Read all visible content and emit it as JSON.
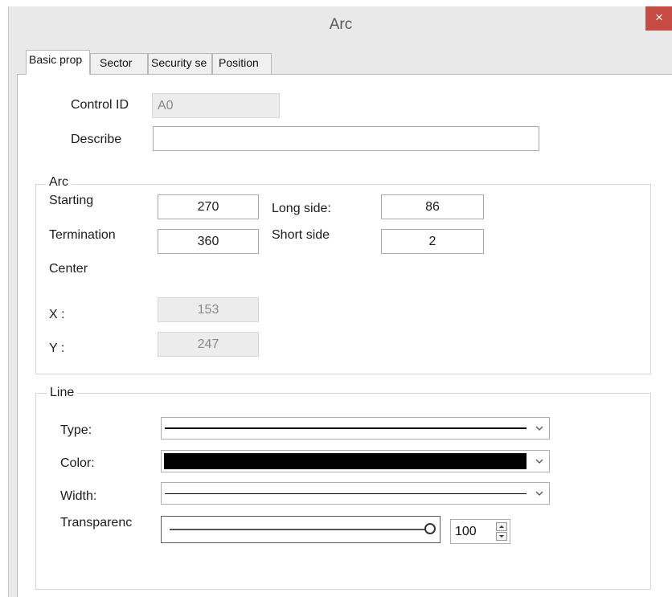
{
  "window": {
    "title": "Arc",
    "close_glyph": "×"
  },
  "tabs": [
    {
      "label": "Basic prop",
      "active": true
    },
    {
      "label": "Sector"
    },
    {
      "label": "Security se"
    },
    {
      "label": "Position"
    }
  ],
  "basic": {
    "control_id_label": "Control ID",
    "control_id_value": "A0",
    "describe_label": "Describe",
    "describe_value": ""
  },
  "arc": {
    "legend": "Arc",
    "starting_label": "Starting",
    "starting_value": "270",
    "termination_label": "Termination",
    "termination_value": "360",
    "long_side_label": "Long side:",
    "long_side_value": "86",
    "short_side_label": "Short side",
    "short_side_value": "2",
    "center_label": "Center",
    "x_label": "X :",
    "x_value": "153",
    "y_label": "Y :",
    "y_value": "247"
  },
  "line": {
    "legend": "Line",
    "type_label": "Type:",
    "color_label": "Color:",
    "color_value": "#000000",
    "width_label": "Width:",
    "transparency_label": "Transparenc",
    "transparency_value": "100",
    "transparency_level": 1.0
  },
  "icons": [
    "close-icon",
    "chevron-down-icon",
    "slider-thumb",
    "spin-up-icon",
    "spin-down-icon"
  ]
}
